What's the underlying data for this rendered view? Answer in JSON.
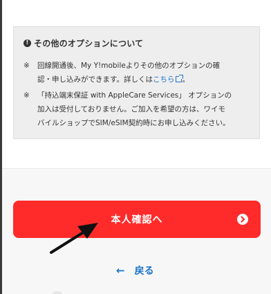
{
  "info": {
    "title": "その他のオプションについて",
    "notes": [
      {
        "mark": "※",
        "line1": "回線開通後、My Y!mobileよりその他のオプションの確",
        "line2_before": "認・申し込みができます。詳しくは",
        "link": "こちら",
        "line2_after": "。"
      },
      {
        "mark": "※",
        "line1": "「持込端末保証 with AppleCare Services」 オプションの",
        "line2": "加入は受付しておりません。ご加入を希望の方は、ワイモ",
        "line3": "バイルショップでSIM/eSIM契約時にお申し込みください。"
      }
    ]
  },
  "cta": {
    "label": "本人確認へ"
  },
  "back": {
    "label": "戻る",
    "arrow": "←"
  },
  "colors": {
    "cta": "#ff2b2b",
    "link": "#1a73c8"
  }
}
